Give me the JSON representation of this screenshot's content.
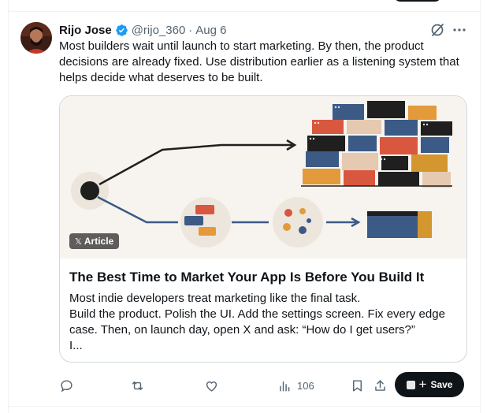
{
  "tweet": {
    "author_name": "Rijo Jose",
    "handle": "@rijo_360",
    "separator": "·",
    "date": "Aug 6",
    "text": "Most builders wait until launch to start marketing. By then, the product decisions are already fixed. Use distribution earlier as a listening system that helps decide what deserves to be built."
  },
  "card": {
    "badge_label": "Article",
    "badge_icon": "x-logo-icon",
    "title": "The Best Time to Market Your App Is Before You Build It",
    "description_lines": [
      "Most indie developers treat marketing like the final task.",
      "Build the product. Polish the UI. Add the settings screen. Fix every edge",
      "case. Then, on launch day, open X and ask: “How do I get users?”",
      "I..."
    ]
  },
  "actions": {
    "views_count": "106",
    "save_label": "Save",
    "save_plus": "+"
  },
  "icons": {
    "reply": "reply-icon",
    "repost": "repost-icon",
    "like": "heart-icon",
    "views": "views-chart-icon",
    "bookmark": "bookmark-icon",
    "share": "share-icon",
    "grok": "grok-icon",
    "more": "more-dots-icon",
    "verified": "verified-badge-icon"
  },
  "colors": {
    "text_primary": "#0f1419",
    "text_secondary": "#536471",
    "verified_blue": "#1d9bf0",
    "border": "#cfd9de",
    "save_button": "#0f1419"
  }
}
